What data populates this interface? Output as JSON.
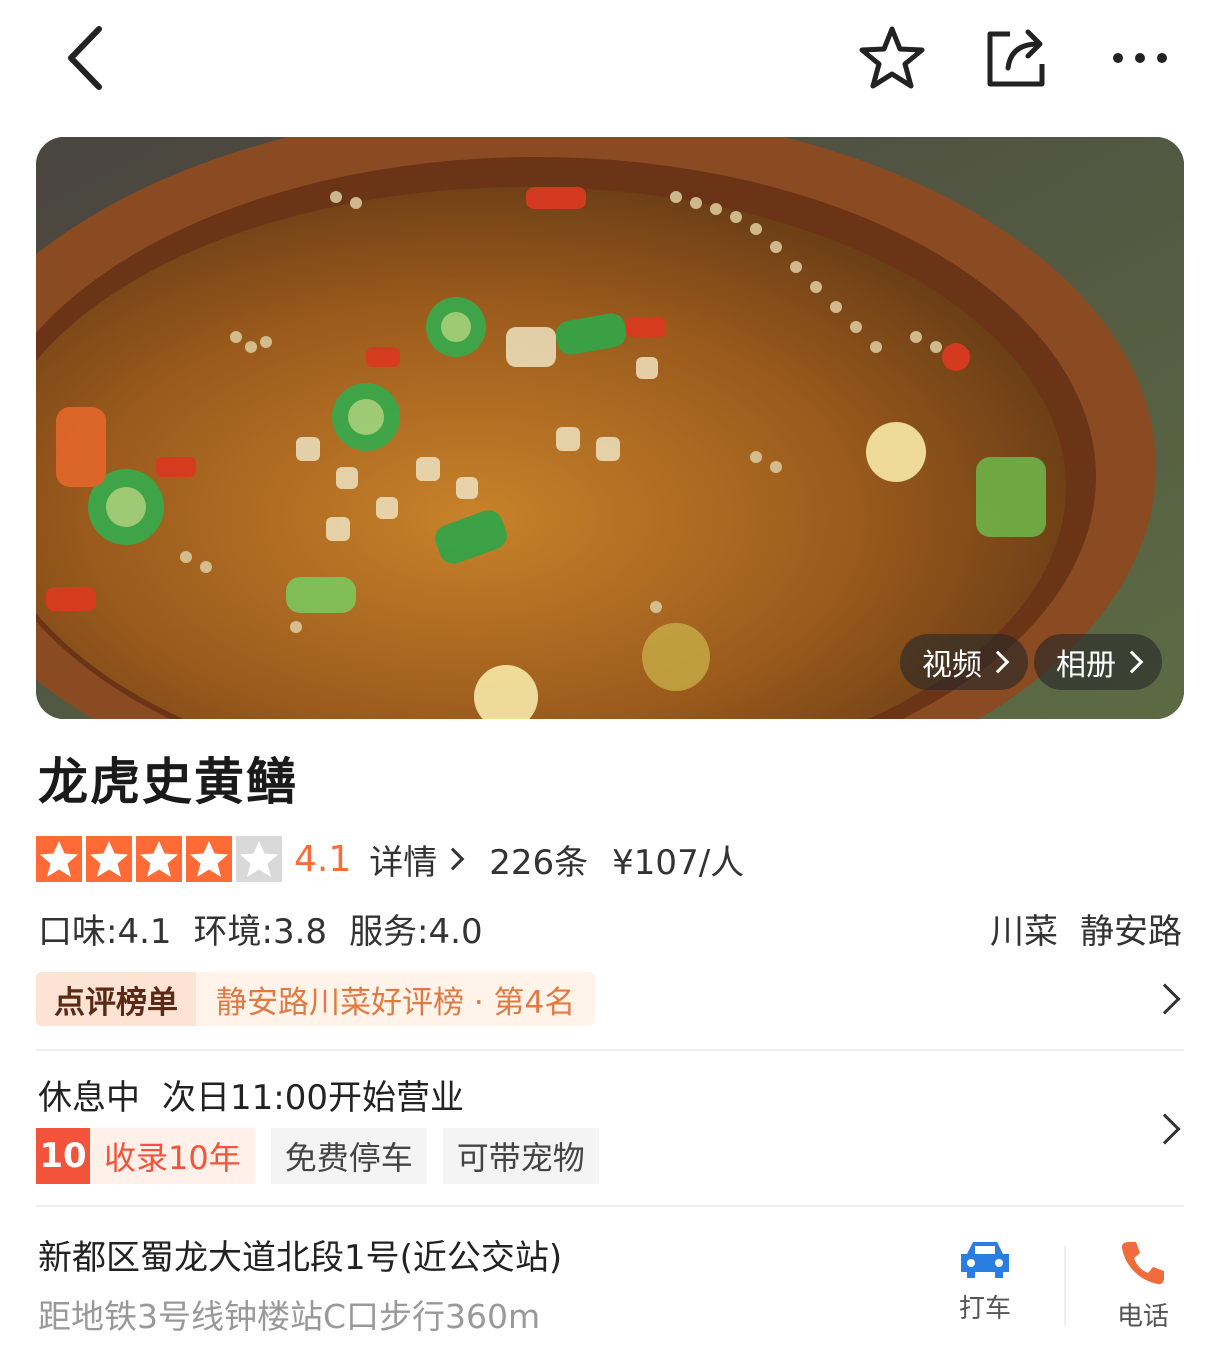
{
  "header": {
    "icons": [
      "back-icon",
      "star-outline-icon",
      "share-icon",
      "more-icon"
    ]
  },
  "hero": {
    "video_label": "视频",
    "album_label": "相册"
  },
  "shop": {
    "name": "龙虎史黄鳝",
    "rating": {
      "stars_filled": 4,
      "stars_total": 5,
      "score": "4.1",
      "detail_label": "详情",
      "reviews": "226条",
      "price": "¥107/人"
    },
    "subscores": {
      "taste": "口味:4.1",
      "environment": "环境:3.8",
      "service": "服务:4.0"
    },
    "category": "川菜",
    "area": "静安路",
    "ranking": {
      "label": "点评榜单",
      "text": "静安路川菜好评榜 · 第4名"
    },
    "hours": {
      "status": "休息中",
      "next_open": "次日11:00开始营业"
    },
    "features": {
      "years_num": "10",
      "years_text": "收录10年",
      "parking": "免费停车",
      "pets": "可带宠物"
    },
    "address": {
      "line": "新都区蜀龙大道北段1号(近公交站)",
      "metro": "距地铁3号线钟楼站C口步行360m"
    },
    "actions": {
      "taxi_label": "打车",
      "call_label": "电话"
    }
  },
  "colors": {
    "accent": "#fe6b37",
    "badge_red": "#f2533a",
    "taxi_blue": "#2a7de1"
  }
}
